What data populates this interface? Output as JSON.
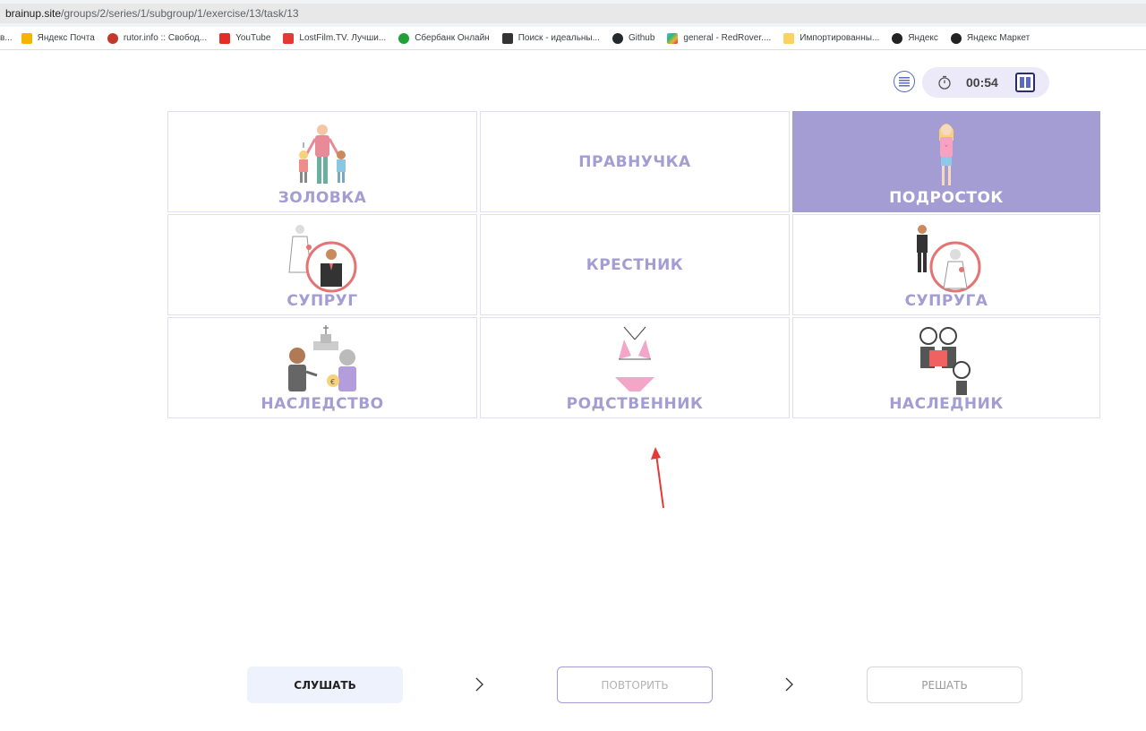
{
  "browser": {
    "url_host": "brainup.site",
    "url_path": "/groups/2/series/1/subgroup/1/exercise/13/task/13",
    "bookmarks": [
      {
        "label": "в...",
        "color": "#ffffff"
      },
      {
        "label": "Яндекс Почта",
        "color": "#f4b400"
      },
      {
        "label": "rutor.info :: Свобод...",
        "color": "#c0392b"
      },
      {
        "label": "YouTube",
        "color": "#e52d27"
      },
      {
        "label": "LostFilm.TV. Лучши...",
        "color": "#e53935"
      },
      {
        "label": "Сбербанк Онлайн",
        "color": "#21a038"
      },
      {
        "label": "Поиск - идеальны...",
        "color": "#333333"
      },
      {
        "label": "Github",
        "color": "#24292e"
      },
      {
        "label": "general - RedRover....",
        "color": "#8e24aa"
      },
      {
        "label": "Импортированны...",
        "color": "#fbd160"
      },
      {
        "label": "Яндекс",
        "color": "#222222"
      },
      {
        "label": "Яндекс Маркет",
        "color": "#222222"
      }
    ]
  },
  "controls": {
    "timer": "00:54"
  },
  "grid": [
    {
      "label": "ЗОЛОВКА",
      "picture": "family-icon",
      "selected": false
    },
    {
      "label": "ПРАВНУЧКА",
      "picture": "",
      "selected": false
    },
    {
      "label": "ПОДРОСТОК",
      "picture": "teen-girl-icon",
      "selected": true
    },
    {
      "label": "СУПРУГ",
      "picture": "groom-icon",
      "selected": false
    },
    {
      "label": "КРЕСТНИК",
      "picture": "",
      "selected": false
    },
    {
      "label": "СУПРУГА",
      "picture": "bride-icon",
      "selected": false
    },
    {
      "label": "НАСЛЕДСТВО",
      "picture": "inheritance-icon",
      "selected": false
    },
    {
      "label": "РОДСТВЕННИК",
      "picture": "swimsuit-icon",
      "selected": false
    },
    {
      "label": "НАСЛЕДНИК",
      "picture": "heir-icon",
      "selected": false
    }
  ],
  "actions": {
    "listen": "СЛУШАТЬ",
    "repeat": "ПОВТОРИТЬ",
    "solve": "РЕШАТЬ"
  },
  "colors": {
    "accent": "#a49dd3",
    "annotation_arrow": "#e53935"
  }
}
